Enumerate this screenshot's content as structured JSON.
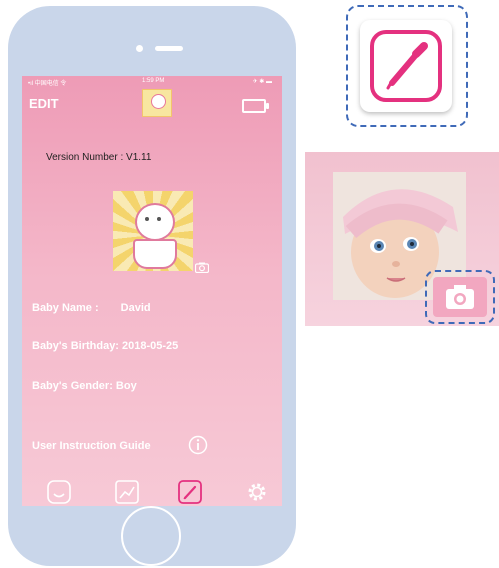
{
  "statusbar": {
    "carrier": "•ıl 中国电信 令",
    "time": "1:59 PM",
    "right": "✈ ✱ ▬"
  },
  "header": {
    "title": "EDIT"
  },
  "version": {
    "text": "Version Number : V1.11"
  },
  "baby": {
    "name_label": "Baby Name :",
    "name_value": "David",
    "birthday": "Baby's Birthday: 2018-05-25",
    "gender": "Baby's Gender: Boy"
  },
  "guide": {
    "label": "User Instruction Guide"
  },
  "tabs": [
    {
      "icon": "baby-face-icon"
    },
    {
      "icon": "chart-icon"
    },
    {
      "icon": "pencil-icon",
      "active": true
    },
    {
      "icon": "gear-icon"
    }
  ],
  "colors": {
    "accent": "#e4317f",
    "pink_top": "#ee9bb6",
    "pink_bottom": "#f7c9d6",
    "frame": "#c9d6ea",
    "callout": "#3f6ab8"
  }
}
